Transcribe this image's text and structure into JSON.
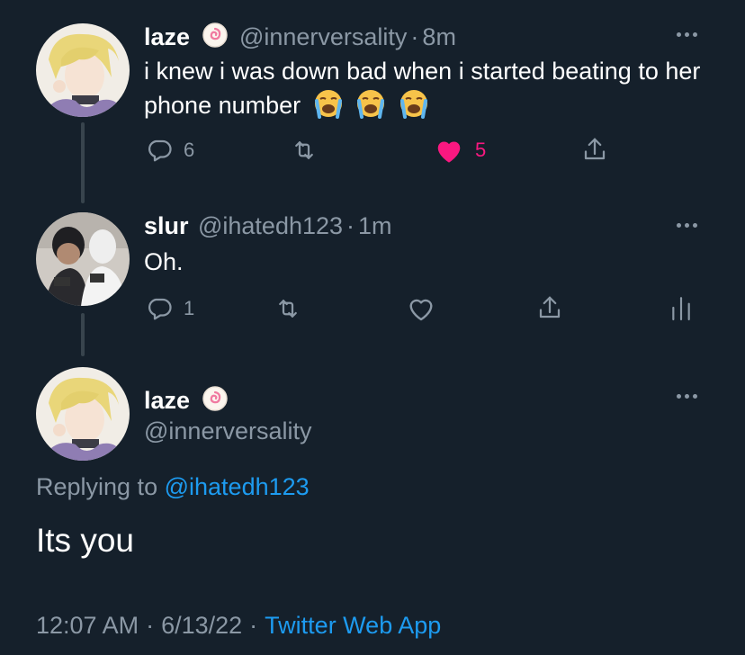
{
  "tweet1": {
    "name": "laze",
    "handle": "@innerversality",
    "time": "8m",
    "text": "i knew i was down bad when i started beating to her phone number",
    "replies": "6",
    "likes": "5",
    "badge_icon": "fishcake-emoji-icon",
    "emoji_icon": "loudly-crying-face-icon",
    "like_color": "#f91880"
  },
  "tweet2": {
    "name": "slur",
    "handle": "@ihatedh123",
    "time": "1m",
    "text": "Oh.",
    "replies": "1"
  },
  "main": {
    "name": "laze",
    "handle": "@innerversality",
    "replying_label": "Replying to",
    "replying_handle": "@ihatedh123",
    "text": "Its you",
    "time": "12:07 AM",
    "date": "6/13/22",
    "source": "Twitter Web App",
    "link_color": "#1d9bf0"
  },
  "separator": "·"
}
